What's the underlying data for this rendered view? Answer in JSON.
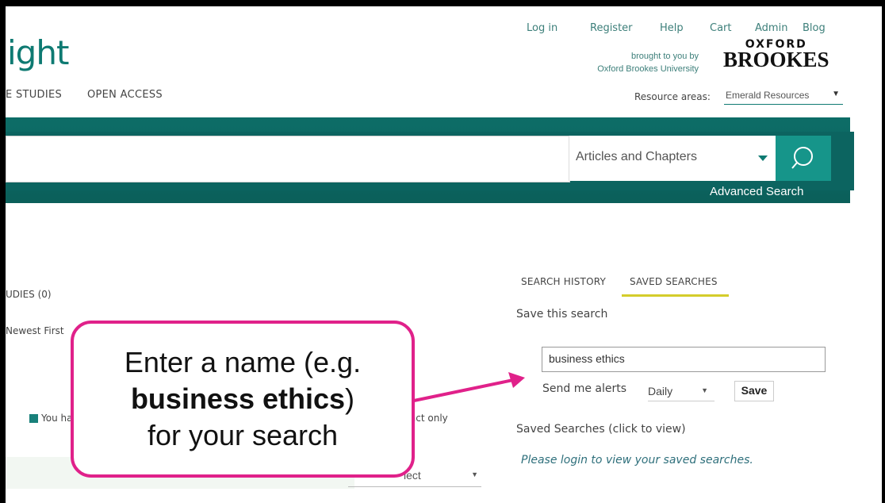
{
  "header": {
    "logo_text": "ight",
    "nav": [
      "E STUDIES",
      "OPEN ACCESS"
    ],
    "top_links": [
      "Log in",
      "Register",
      "Help",
      "Cart",
      "Admin",
      "Blog"
    ],
    "brought_line1": "brought to you by",
    "brought_line2": "Oxford Brookes University",
    "institution_line1": "OXFORD",
    "institution_line2": "BROOKES",
    "resource_areas_label": "Resource areas:",
    "resource_areas_value": "Emerald Resources"
  },
  "search": {
    "type_selected": "Articles and Chapters",
    "advanced_label": "Advanced Search"
  },
  "results": {
    "case_studies_label": "UDIES (0)",
    "sort_label": "Newest First",
    "access_legend": "You ha",
    "abstract_only": "ract only",
    "select_value": "lect"
  },
  "sidebar": {
    "tabs": [
      "SEARCH HISTORY",
      "SAVED SEARCHES"
    ],
    "save_heading": "Save this search",
    "search_name_value": "business ethics",
    "alerts_label": "Send me alerts",
    "alerts_value": "Daily",
    "save_button": "Save",
    "saved_heading": "Saved Searches (click to view)",
    "login_prompt": "Please login to view your saved searches."
  },
  "callout": {
    "line1": "Enter a name (e.g.",
    "line2_bold": "business ethics",
    "line2_rest": ")",
    "line3": "for your search"
  },
  "colors": {
    "brand_teal": "#0e7a72",
    "search_button": "#16958a",
    "tab_underline": "#d4cd2b",
    "callout_border": "#e0218a"
  }
}
